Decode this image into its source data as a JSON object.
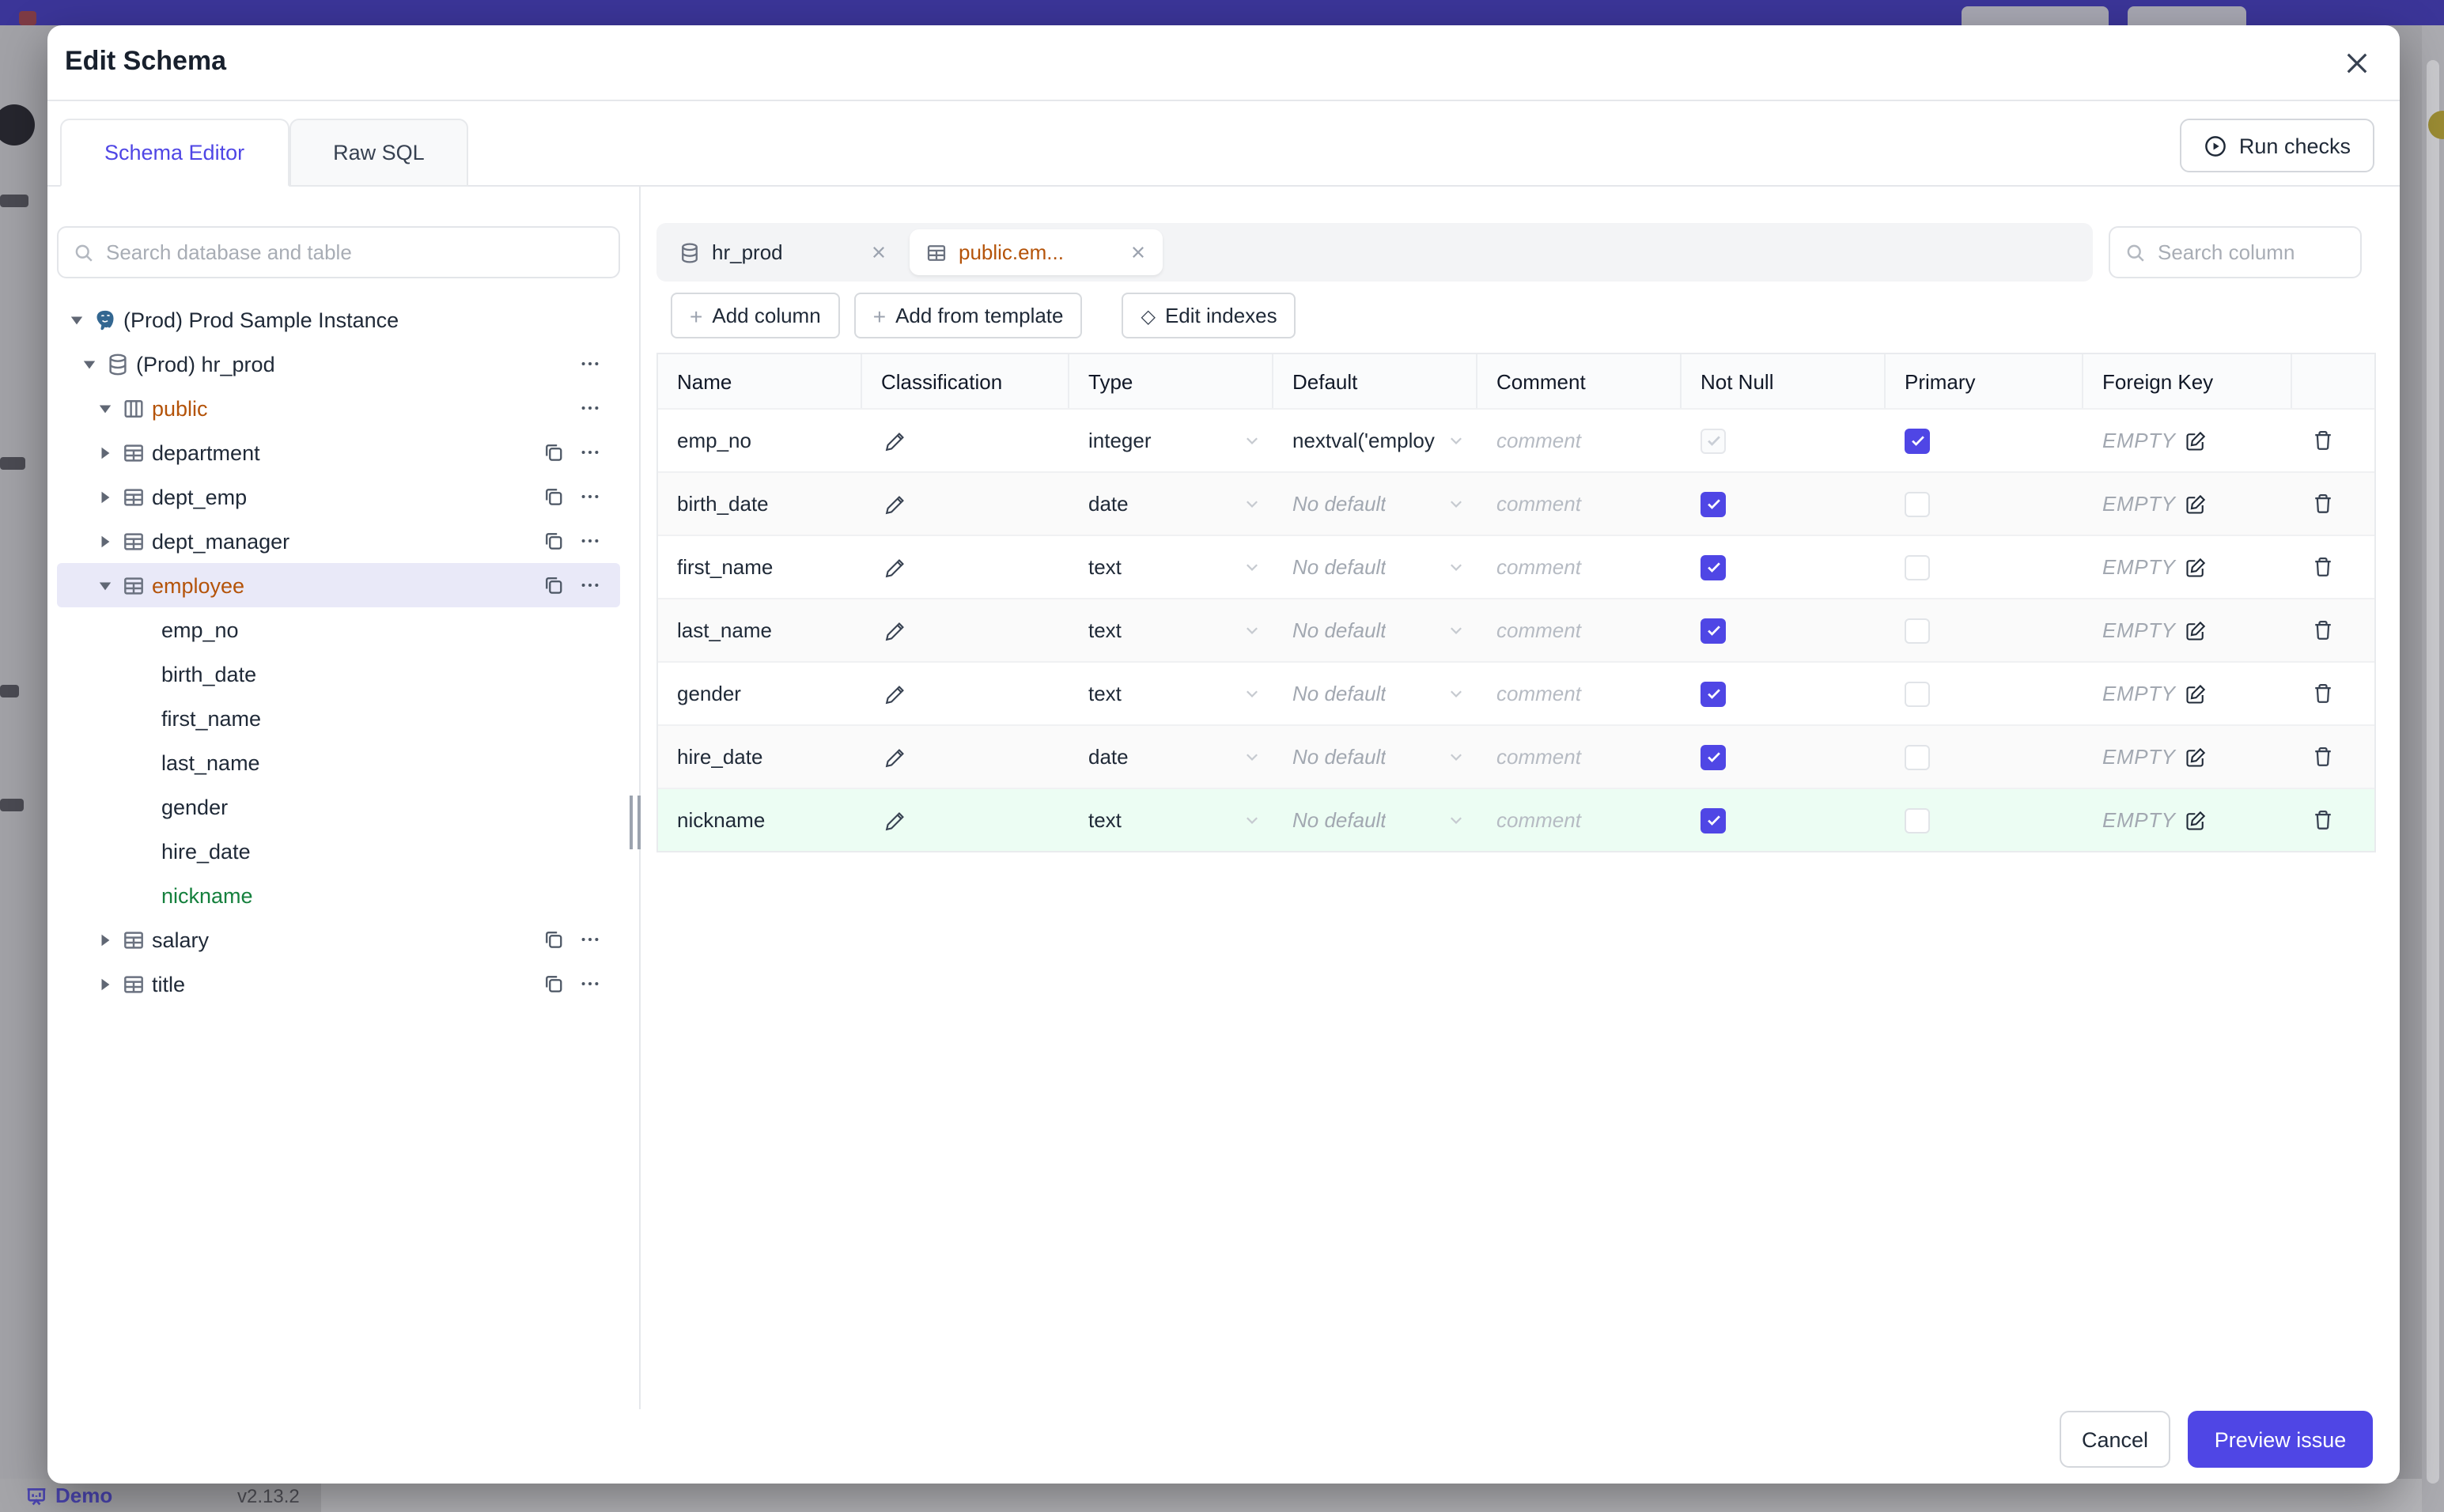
{
  "colors": {
    "accent": "#4f46e5",
    "amber": "#b45309",
    "green": "#15803d",
    "row_selected": "#e9e9f8",
    "row_green": "#ecfdf3",
    "topbar": "#3b3598"
  },
  "modal": {
    "title": "Edit Schema",
    "tabs": [
      {
        "label": "Schema Editor",
        "active": true
      },
      {
        "label": "Raw SQL",
        "active": false
      }
    ],
    "run_checks_label": "Run checks"
  },
  "sidebar": {
    "search_placeholder": "Search database and table",
    "tree": [
      {
        "id": "instance",
        "label": "(Prod) Prod Sample Instance",
        "icon": "postgres-icon",
        "caret": "down",
        "indent": 0
      },
      {
        "id": "database",
        "label": "(Prod) hr_prod",
        "icon": "database-icon",
        "caret": "down",
        "indent": 1,
        "actions": [
          "more"
        ]
      },
      {
        "id": "schema",
        "label": "public",
        "icon": "schema-icon",
        "caret": "down",
        "indent": 2,
        "color": "amber",
        "actions": [
          "more"
        ]
      },
      {
        "id": "department",
        "label": "department",
        "icon": "table-icon",
        "caret": "right",
        "indent": 2,
        "actions": [
          "copy",
          "more"
        ]
      },
      {
        "id": "dept_emp",
        "label": "dept_emp",
        "icon": "table-icon",
        "caret": "right",
        "indent": 2,
        "actions": [
          "copy",
          "more"
        ]
      },
      {
        "id": "dept_manager",
        "label": "dept_manager",
        "icon": "table-icon",
        "caret": "right",
        "indent": 2,
        "actions": [
          "copy",
          "more"
        ]
      },
      {
        "id": "employee",
        "label": "employee",
        "icon": "table-icon",
        "caret": "down",
        "indent": 2,
        "color": "amber",
        "selected": true,
        "actions": [
          "copy",
          "more"
        ]
      },
      {
        "id": "emp_no",
        "label": "emp_no",
        "indent": 4,
        "leaf": true
      },
      {
        "id": "birth_date",
        "label": "birth_date",
        "indent": 4,
        "leaf": true
      },
      {
        "id": "first_name",
        "label": "first_name",
        "indent": 4,
        "leaf": true
      },
      {
        "id": "last_name",
        "label": "last_name",
        "indent": 4,
        "leaf": true
      },
      {
        "id": "gender",
        "label": "gender",
        "indent": 4,
        "leaf": true
      },
      {
        "id": "hire_date",
        "label": "hire_date",
        "indent": 4,
        "leaf": true
      },
      {
        "id": "nickname",
        "label": "nickname",
        "indent": 4,
        "leaf": true,
        "color": "green"
      },
      {
        "id": "salary",
        "label": "salary",
        "icon": "table-icon",
        "caret": "right",
        "indent": 2,
        "actions": [
          "copy",
          "more"
        ]
      },
      {
        "id": "title",
        "label": "title",
        "icon": "table-icon",
        "caret": "right",
        "indent": 2,
        "actions": [
          "copy",
          "more"
        ]
      }
    ]
  },
  "main": {
    "tabs": [
      {
        "label": "hr_prod",
        "icon": "database-icon",
        "active": false
      },
      {
        "label": "public.em...",
        "icon": "table-icon",
        "active": true
      }
    ],
    "column_search_placeholder": "Search column",
    "actions": [
      {
        "label": "Add column",
        "icon": "plus-icon"
      },
      {
        "label": "Add from template",
        "icon": "plus-icon"
      },
      {
        "label": "Edit indexes",
        "icon": "diamond-icon"
      }
    ],
    "table": {
      "headers": [
        "Name",
        "Classification",
        "Type",
        "Default",
        "Comment",
        "Not Null",
        "Primary",
        "Foreign Key",
        ""
      ],
      "comment_placeholder": "comment",
      "no_default_placeholder": "No default",
      "foreign_key_value": "EMPTY",
      "rows": [
        {
          "name": "emp_no",
          "type": "integer",
          "default": "nextval('employ",
          "default_placeholder": false,
          "not_null": "checked-disabled",
          "primary": "checked",
          "highlight": false
        },
        {
          "name": "birth_date",
          "type": "date",
          "default": "No default",
          "default_placeholder": true,
          "not_null": "checked",
          "primary": "unchecked",
          "highlight": false
        },
        {
          "name": "first_name",
          "type": "text",
          "default": "No default",
          "default_placeholder": true,
          "not_null": "checked",
          "primary": "unchecked",
          "highlight": false
        },
        {
          "name": "last_name",
          "type": "text",
          "default": "No default",
          "default_placeholder": true,
          "not_null": "checked",
          "primary": "unchecked",
          "highlight": false
        },
        {
          "name": "gender",
          "type": "text",
          "default": "No default",
          "default_placeholder": true,
          "not_null": "checked",
          "primary": "unchecked",
          "highlight": false
        },
        {
          "name": "hire_date",
          "type": "date",
          "default": "No default",
          "default_placeholder": true,
          "not_null": "checked",
          "primary": "unchecked",
          "highlight": false
        },
        {
          "name": "nickname",
          "type": "text",
          "default": "No default",
          "default_placeholder": true,
          "not_null": "checked",
          "primary": "unchecked",
          "highlight": true
        }
      ]
    }
  },
  "footer": {
    "cancel_label": "Cancel",
    "primary_label": "Preview issue"
  },
  "statusbar": {
    "demo_label": "Demo",
    "version": "v2.13.2"
  }
}
